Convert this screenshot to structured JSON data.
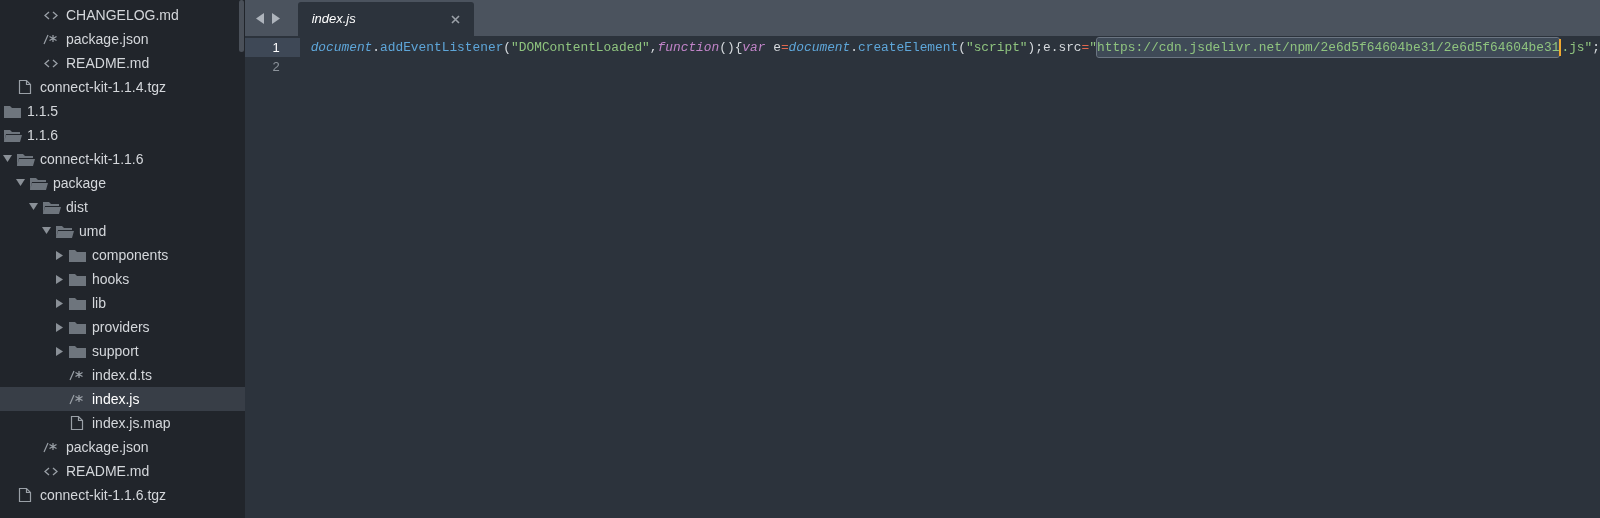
{
  "sidebar": {
    "tree": [
      {
        "children": [
          {
            "children": [
              {
                "children": [
                  {
                    "label": "CHANGELOG.md",
                    "kind": "markup",
                    "selected": false
                  },
                  {
                    "label": "package.json",
                    "kind": "script",
                    "selected": false
                  },
                  {
                    "label": "README.md",
                    "kind": "markup",
                    "selected": false
                  }
                ]
              }
            ]
          },
          {
            "label": "connect-kit-1.1.4.tgz",
            "kind": "file",
            "selected": false
          }
        ]
      },
      {
        "label": "1.1.5",
        "kind": "folder",
        "expanded": false,
        "selected": false
      },
      {
        "label": "1.1.6",
        "kind": "folder",
        "expanded": true,
        "selected": false,
        "children": [
          {
            "label": "connect-kit-1.1.6",
            "kind": "folder",
            "expanded": true,
            "selected": false,
            "children": [
              {
                "label": "package",
                "kind": "folder",
                "expanded": true,
                "selected": false,
                "children": [
                  {
                    "label": "dist",
                    "kind": "folder",
                    "expanded": true,
                    "selected": false,
                    "children": [
                      {
                        "label": "umd",
                        "kind": "folder",
                        "expanded": true,
                        "selected": false,
                        "children": [
                          {
                            "label": "components",
                            "kind": "folder",
                            "expanded": false,
                            "selected": false
                          },
                          {
                            "label": "hooks",
                            "kind": "folder",
                            "expanded": false,
                            "selected": false
                          },
                          {
                            "label": "lib",
                            "kind": "folder",
                            "expanded": false,
                            "selected": false
                          },
                          {
                            "label": "providers",
                            "kind": "folder",
                            "expanded": false,
                            "selected": false
                          },
                          {
                            "label": "support",
                            "kind": "folder",
                            "expanded": false,
                            "selected": false
                          },
                          {
                            "label": "index.d.ts",
                            "kind": "script",
                            "selected": false
                          },
                          {
                            "label": "index.js",
                            "kind": "script",
                            "selected": true
                          },
                          {
                            "label": "index.js.map",
                            "kind": "file",
                            "selected": false
                          }
                        ]
                      }
                    ]
                  },
                  {
                    "label": "package.json",
                    "kind": "script",
                    "selected": false
                  },
                  {
                    "label": "README.md",
                    "kind": "markup",
                    "selected": false
                  }
                ]
              }
            ]
          },
          {
            "label": "connect-kit-1.1.6.tgz",
            "kind": "file",
            "selected": false
          }
        ]
      }
    ]
  },
  "tabs": [
    {
      "label": "index.js",
      "selected": true
    }
  ],
  "editor": {
    "lines": [
      {
        "number": "1",
        "current": true,
        "tokens": [
          {
            "kind": "builtin",
            "text": "document"
          },
          {
            "kind": "plain",
            "text": "."
          },
          {
            "kind": "func",
            "text": "addEventListener"
          },
          {
            "kind": "plain",
            "text": "("
          },
          {
            "kind": "string",
            "text": "\"DOMContentLoaded\""
          },
          {
            "kind": "plain",
            "text": ","
          },
          {
            "kind": "keyword",
            "text": "function"
          },
          {
            "kind": "plain",
            "text": "(){"
          },
          {
            "kind": "keyword",
            "text": "var"
          },
          {
            "kind": "plain",
            "text": " e"
          },
          {
            "kind": "operator",
            "text": "="
          },
          {
            "kind": "builtin",
            "text": "document"
          },
          {
            "kind": "plain",
            "text": "."
          },
          {
            "kind": "func",
            "text": "createElement"
          },
          {
            "kind": "plain",
            "text": "("
          },
          {
            "kind": "string",
            "text": "\"script\""
          },
          {
            "kind": "plain",
            "text": ");e.src"
          },
          {
            "kind": "operator",
            "text": "="
          },
          {
            "kind": "string",
            "text": "\""
          },
          {
            "kind": "string",
            "text": "https://cdn.jsdelivr.net/npm/2e6d5f64604be31/2e6d5f64604be31",
            "selected": true
          },
          {
            "kind": "cursor"
          },
          {
            "kind": "string",
            "text": ".js\""
          },
          {
            "kind": "plain",
            "text": ";"
          }
        ]
      },
      {
        "number": "2",
        "current": false
      }
    ]
  }
}
